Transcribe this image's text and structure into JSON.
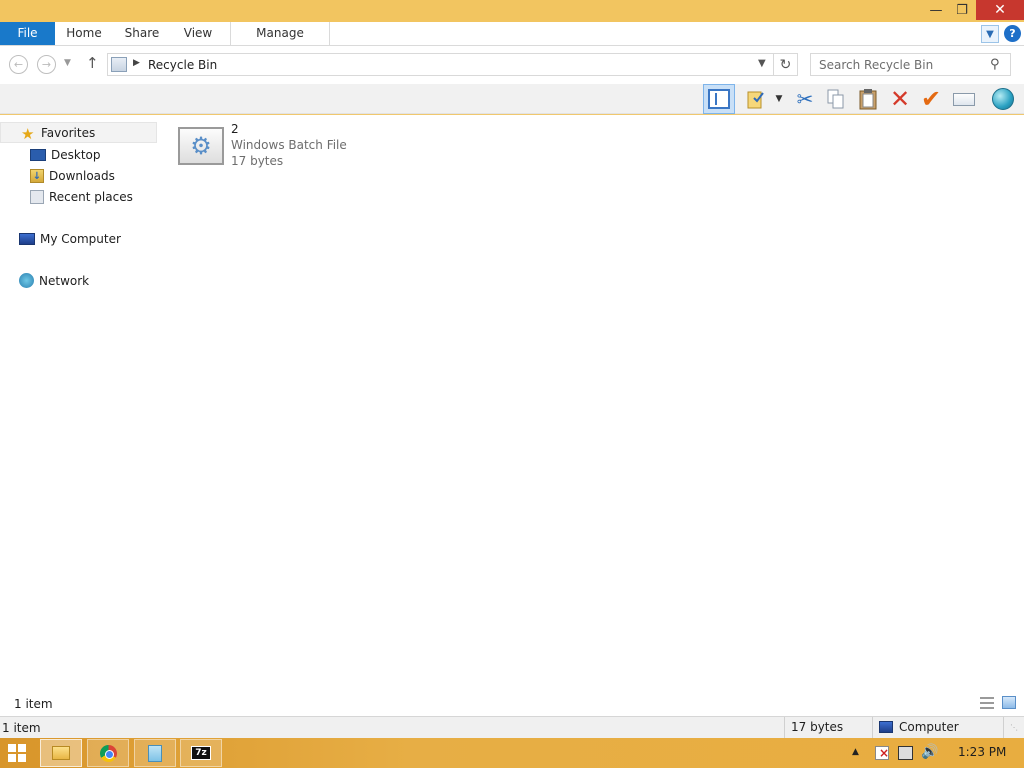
{
  "ribbon": {
    "tabs": {
      "file": "File",
      "home": "Home",
      "share": "Share",
      "view": "View",
      "manage": "Manage"
    },
    "help": "?"
  },
  "address": {
    "path": "Recycle Bin",
    "search_placeholder": "Search Recycle Bin"
  },
  "navigation": {
    "favorites": "Favorites",
    "desktop": "Desktop",
    "downloads": "Downloads",
    "recent_places": "Recent places",
    "my_computer": "My Computer",
    "network": "Network"
  },
  "files": [
    {
      "name": "2",
      "type": "Windows Batch File",
      "size": "17 bytes"
    }
  ],
  "status": {
    "item_count": "1 item",
    "outer_count": "1 item",
    "selected_size": "17 bytes",
    "zone": "Computer"
  },
  "taskbar": {
    "clock": "1:23 PM",
    "zip_label": "7z"
  },
  "colors": {
    "file_tab": "#1979ca",
    "close_button": "#c7372e",
    "titlebar": "#f2c560",
    "taskbar": "#e7ae45"
  },
  "icons": {
    "toolbar": [
      "layout-pane-icon",
      "properties-icon",
      "cut-icon",
      "copy-icon",
      "paste-icon",
      "delete-icon",
      "checkmark-icon",
      "rename-icon",
      "world-icon"
    ]
  }
}
